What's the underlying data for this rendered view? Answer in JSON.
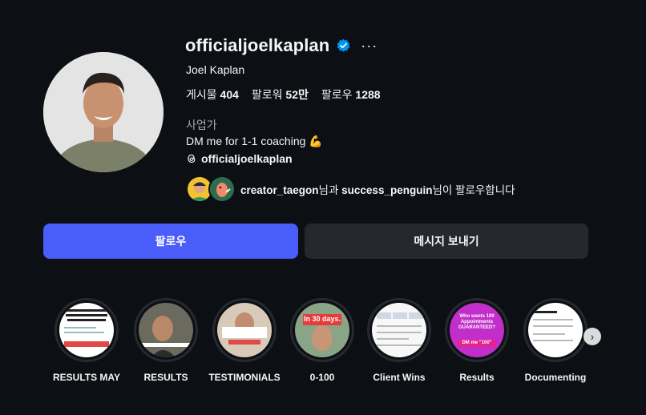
{
  "profile": {
    "username": "officialjoelkaplan",
    "more_glyph": "···",
    "full_name": "Joel Kaplan",
    "category": "사업가",
    "bio": "DM me for 1-1 coaching 💪",
    "threads_handle": "officialjoelkaplan"
  },
  "stats": {
    "posts_label": "게시물",
    "posts_value": "404",
    "followers_label": "팔로워",
    "followers_value": "52만",
    "following_label": "팔로우",
    "following_value": "1288"
  },
  "followed_by": {
    "user1": "creator_taegon",
    "joiner": "님과",
    "user2": "success_penguin",
    "suffix": "님이 팔로우합니다"
  },
  "buttons": {
    "follow": "팔로우",
    "message": "메시지 보내기"
  },
  "highlights": [
    {
      "label": "RESULTS MAY"
    },
    {
      "label": "RESULTS"
    },
    {
      "label": "TESTIMONIALS"
    },
    {
      "label": "0-100",
      "overlay": "In 30 days."
    },
    {
      "label": "Client Wins"
    },
    {
      "label": "Results",
      "overlay": "Who wants 100 Appointments GUARANTEED?",
      "overlay2": "DM me \"100\""
    },
    {
      "label": "Documenting"
    }
  ],
  "colors": {
    "background": "#0c1014",
    "follow_button": "#4a5df9",
    "message_button": "#25292e",
    "verified_badge": "#0095f6",
    "secondary_text": "#a8a8a8"
  },
  "icons": {
    "verified": "verified-badge-icon",
    "threads": "threads-icon",
    "more": "more-options-icon",
    "next": "chevron-right-icon"
  }
}
